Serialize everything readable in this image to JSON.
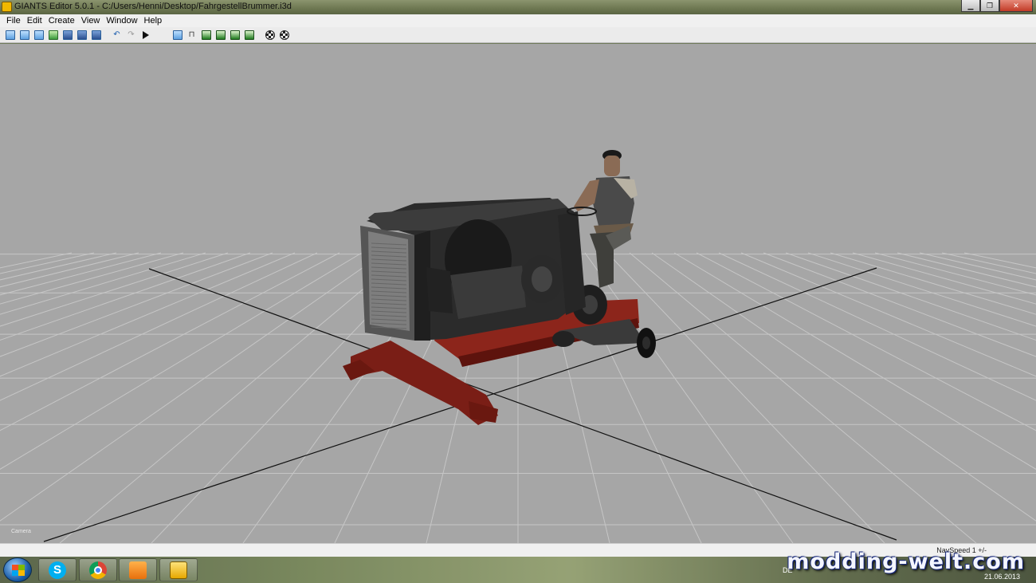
{
  "window": {
    "title": "GIANTS Editor 5.0.1 - C:/Users/Henni/Desktop/FahrgestellBrummer.i3d",
    "minimize_glyph": "▁",
    "maximize_glyph": "❐",
    "close_glyph": "✕"
  },
  "menu": {
    "items": [
      {
        "label": "File"
      },
      {
        "label": "Edit"
      },
      {
        "label": "Create"
      },
      {
        "label": "View"
      },
      {
        "label": "Window"
      },
      {
        "label": "Help"
      }
    ]
  },
  "toolbar": {
    "icons": [
      "new-icon",
      "open-icon",
      "import-icon",
      "reload-icon",
      "save-icon",
      "save-as-icon",
      "export-icon",
      "undo-icon",
      "redo-icon",
      "play-icon",
      "select-icon",
      "move-icon",
      "terrain-sculpt-icon",
      "terrain-paint-icon",
      "terrain-foliage-icon",
      "terrain-detail-icon",
      "navmesh-icon",
      "cloth-icon"
    ]
  },
  "viewport": {
    "camera_label": "Camera",
    "background_color": "#a6a6a6"
  },
  "statusbar": {
    "nav_speed": "NavSpeed 1 +/-"
  },
  "taskbar": {
    "apps": [
      "skype",
      "chrome",
      "media-player",
      "giants-editor"
    ],
    "language": "DE",
    "date": "21.06.2013"
  },
  "watermark": {
    "text": "modding-welt.com"
  }
}
